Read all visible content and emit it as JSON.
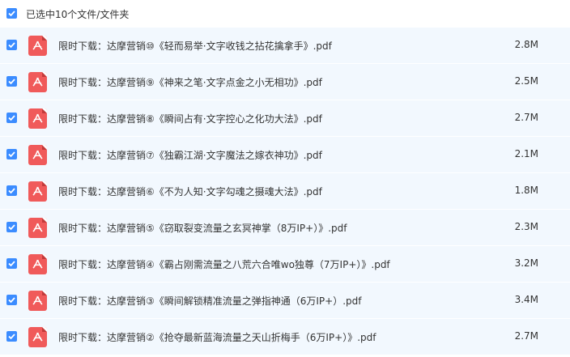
{
  "header": {
    "select_label": "已选中10个文件/文件夹"
  },
  "files": [
    {
      "name": "限时下载：达摩营销⑩《轻而易举·文字收钱之拈花擒拿手》.pdf",
      "size": "2.8M"
    },
    {
      "name": "限时下载：达摩营销⑨《神来之笔·文字点金之小无相功》.pdf",
      "size": "2.5M"
    },
    {
      "name": "限时下载：达摩营销⑧《瞬间占有·文字控心之化功大法》.pdf",
      "size": "2.7M"
    },
    {
      "name": "限时下载：达摩营销⑦《独霸江湖·文字魔法之嫁衣神功》.pdf",
      "size": "2.1M"
    },
    {
      "name": "限时下载：达摩营销⑥《不为人知·文字勾魂之摄魂大法》.pdf",
      "size": "1.8M"
    },
    {
      "name": "限时下载：达摩营销⑤《窃取裂变流量之玄冥神掌（8万IP+）》.pdf",
      "size": "2.3M"
    },
    {
      "name": "限时下载：达摩营销④《霸占刚需流量之八荒六合唯wo独尊（7万IP+）》.pdf",
      "size": "3.2M"
    },
    {
      "name": "限时下载：达摩营销③《瞬间解锁精准流量之弹指神通（6万IP+）.pdf",
      "size": "3.4M"
    },
    {
      "name": "限时下载：达摩营销②《抢夺最新蓝海流量之天山折梅手（6万IP+）》.pdf",
      "size": "2.7M"
    }
  ],
  "colors": {
    "accent": "#3b8cff",
    "row_bg": "#f2f8fe",
    "pdf_icon": "#f05a5a"
  }
}
